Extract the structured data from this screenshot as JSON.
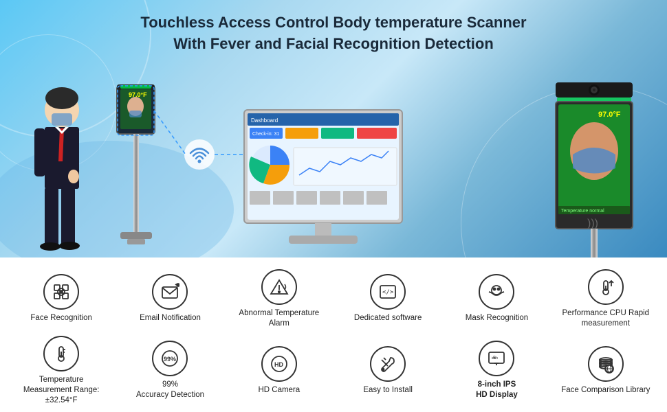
{
  "header": {
    "title_line1": "Touchless Access Control Body temperature Scanner",
    "title_line2": "With Fever and Facial Recognition Detection"
  },
  "features_row1": [
    {
      "id": "face-recognition",
      "label": "Face Recognition",
      "icon": "face"
    },
    {
      "id": "email-notification",
      "label": "Email Notification",
      "icon": "email"
    },
    {
      "id": "abnormal-temp",
      "label": "Abnormal Temperature\nAlarm",
      "icon": "alarm"
    },
    {
      "id": "dedicated-software",
      "label": "Dedicated software",
      "icon": "code"
    },
    {
      "id": "mask-recognition",
      "label": "Mask Recognition",
      "icon": "mask"
    },
    {
      "id": "performance-cpu",
      "label": "Performance CPU\nRapid measurement",
      "icon": "cpu"
    }
  ],
  "features_row2": [
    {
      "id": "temperature-range",
      "label": "Temperature\nMeasurement Range:±32.54°F",
      "icon": "thermometer"
    },
    {
      "id": "accuracy-detection",
      "label": "99%\nAccuracy Detection",
      "icon": "percent"
    },
    {
      "id": "hd-camera",
      "label": "HD Camera",
      "icon": "hd"
    },
    {
      "id": "easy-install",
      "label": "Easy to Install",
      "icon": "tools"
    },
    {
      "id": "8inch-display",
      "label": "8-inch IPS\nHD Display",
      "icon": "display",
      "bold": true
    },
    {
      "id": "face-comparison",
      "label": "Face Comparison Library",
      "icon": "database"
    }
  ],
  "monitor": {
    "temp_reading": "97.0°F",
    "status": "Temperature normal"
  }
}
